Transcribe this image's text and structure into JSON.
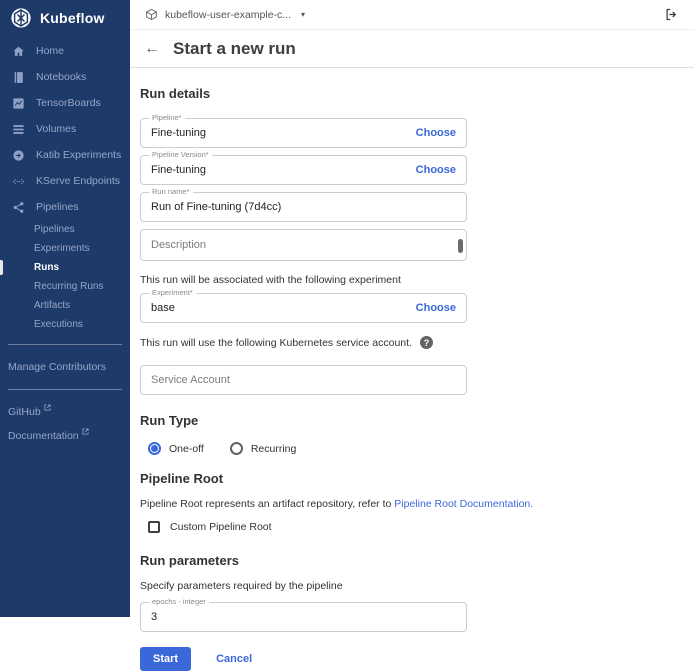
{
  "icons": {
    "caret_down": "▾",
    "back_arrow": "←",
    "help": "?"
  },
  "brand": {
    "name": "Kubeflow"
  },
  "topbar": {
    "namespace": "kubeflow-user-example-c..."
  },
  "header": {
    "title": "Start a new run"
  },
  "sidebar": {
    "items": [
      {
        "label": "Home"
      },
      {
        "label": "Notebooks"
      },
      {
        "label": "TensorBoards"
      },
      {
        "label": "Volumes"
      },
      {
        "label": "Katib Experiments"
      },
      {
        "label": "KServe Endpoints"
      },
      {
        "label": "Pipelines"
      }
    ],
    "pipelines_sub": [
      {
        "label": "Pipelines"
      },
      {
        "label": "Experiments"
      },
      {
        "label": "Runs"
      },
      {
        "label": "Recurring Runs"
      },
      {
        "label": "Artifacts"
      },
      {
        "label": "Executions"
      }
    ],
    "active_sub_item": "Runs",
    "manage": "Manage Contributors",
    "github": "GitHub",
    "documentation": "Documentation"
  },
  "run_details": {
    "heading": "Run details",
    "pipeline": {
      "label": "Pipeline*",
      "value": "Fine-tuning",
      "action": "Choose"
    },
    "pipeline_version": {
      "label": "Pipeline Version*",
      "value": "Fine-tuning",
      "action": "Choose"
    },
    "run_name": {
      "label": "Run name*",
      "value": "Run of Fine-tuning (7d4cc)"
    },
    "description": {
      "placeholder": "Description"
    },
    "experiment_note": "This run will be associated with the following experiment",
    "experiment": {
      "label": "Experiment*",
      "value": "base",
      "action": "Choose"
    },
    "service_note": "This run will use the following Kubernetes service account.",
    "service_account": {
      "placeholder": "Service Account"
    }
  },
  "run_type": {
    "heading": "Run Type",
    "options": [
      {
        "label": "One-off",
        "selected": true
      },
      {
        "label": "Recurring",
        "selected": false
      }
    ]
  },
  "pipeline_root": {
    "heading": "Pipeline Root",
    "text": "Pipeline Root represents an artifact repository, refer to ",
    "link": "Pipeline Root Documentation.",
    "checkbox_label": "Custom Pipeline Root",
    "checked": false
  },
  "run_parameters": {
    "heading": "Run parameters",
    "hint": "Specify parameters required by the pipeline",
    "param": {
      "label": "epochs - integer",
      "value": "3"
    }
  },
  "actions": {
    "start": "Start",
    "cancel": "Cancel"
  },
  "colors": {
    "accent": "#3b68d9",
    "sidebar_bg": "#1e3a68"
  }
}
